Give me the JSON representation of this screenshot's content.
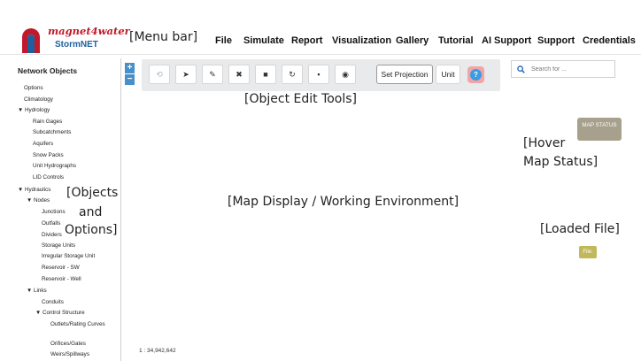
{
  "header": {
    "brand": "magnet4water",
    "product": "StormNET",
    "annotation": "[Menu bar]",
    "nav": [
      "File",
      "Simulate",
      "Report",
      "Visualization",
      "Gallery",
      "Tutorial",
      "AI Support",
      "Support",
      "Credentials"
    ],
    "brand_color": "#c0192c",
    "product_color": "#1f5f9e"
  },
  "sidebar": {
    "title": "Network Objects",
    "annotation_lines": [
      "[Objects",
      "and",
      "Options]"
    ],
    "items": [
      {
        "label": "Options"
      },
      {
        "label": "Climatology"
      },
      {
        "label": "▼ Hydrology"
      },
      {
        "label": "Rain Gages"
      },
      {
        "label": "Subcatchments"
      },
      {
        "label": "Aquifers"
      },
      {
        "label": "Snow Packs"
      },
      {
        "label": "Unit Hydrographs"
      },
      {
        "label": "LID Controls"
      },
      {
        "label": "▼ Hydraulics"
      },
      {
        "label": "▼ Nodes"
      },
      {
        "label": "Junctions"
      },
      {
        "label": "Outfalls"
      },
      {
        "label": "Dividers"
      },
      {
        "label": "Storage Units"
      },
      {
        "label": "Irregular Storage Unit"
      },
      {
        "label": "Reservoir - SW"
      },
      {
        "label": "Reservoir - Well"
      },
      {
        "label": "▼ Links"
      },
      {
        "label": "Conduits"
      },
      {
        "label": "▼ Control Structure"
      },
      {
        "label": "Outlets/Rating Curves"
      },
      {
        "label": "Orifices/Gates"
      },
      {
        "label": "Weirs/Spillways"
      }
    ]
  },
  "zoom": {
    "in": "+",
    "out": "−"
  },
  "toolbar": {
    "annotation": "[Object Edit Tools]",
    "icons": [
      "undo-icon",
      "pointer-icon",
      "edit-icon",
      "delete-icon",
      "truck-icon",
      "refresh-icon",
      "trash-icon",
      "target-icon"
    ],
    "glyphs": [
      "⟲",
      "➤",
      "✎",
      "✖",
      "■",
      "↻",
      "▪",
      "◉"
    ],
    "set_projection": "Set Projection",
    "unit": "Unit",
    "help_glyph": "?"
  },
  "search": {
    "placeholder": "Search for ..."
  },
  "map": {
    "annotation": "[Map Display / Working Environment]",
    "status_label": "MAP STATUS",
    "hover_annotation_lines": [
      "[Hover",
      "Map Status]"
    ],
    "loaded_annotation": "[Loaded File]",
    "file_label": "File:",
    "scale": "1 : 34,942,642",
    "status_color": "#a7a08c",
    "file_color": "#c1b85a"
  }
}
